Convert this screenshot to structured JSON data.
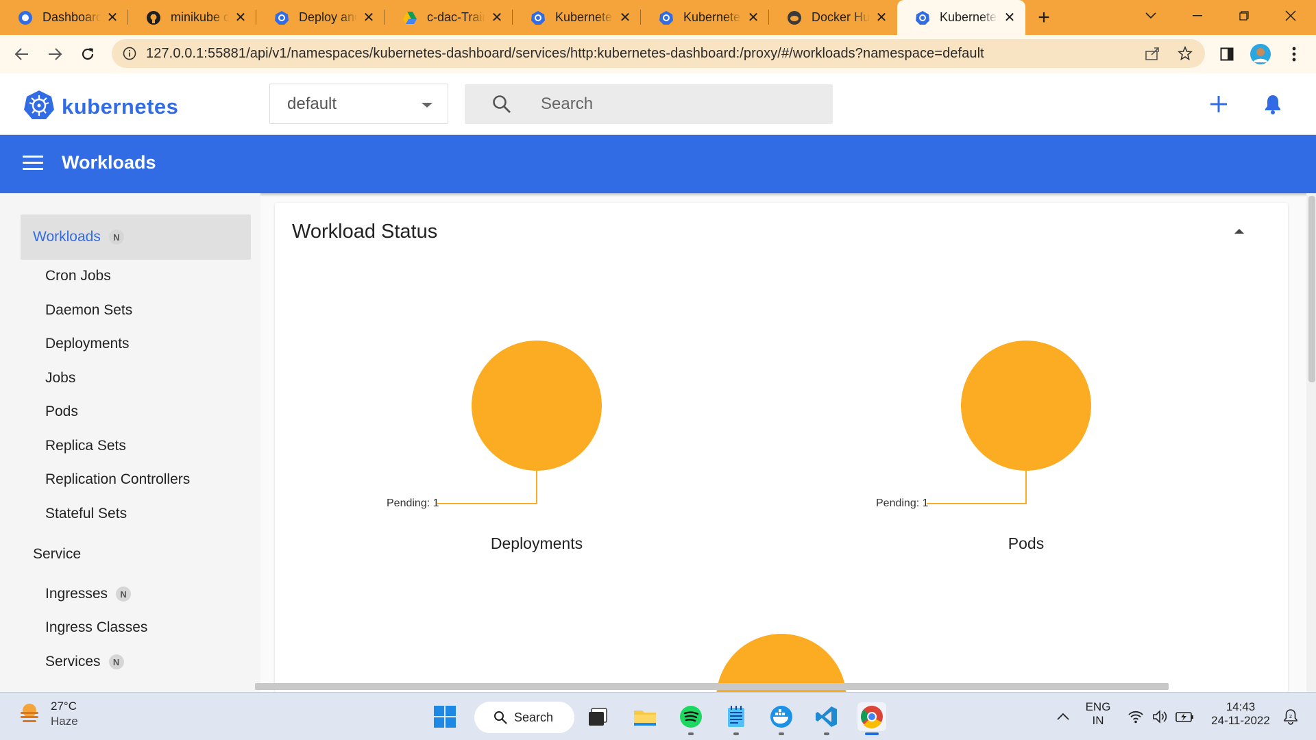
{
  "browser": {
    "tabs": [
      {
        "label": "Dashboard",
        "icon": "dashboard-favicon"
      },
      {
        "label": "minikube d",
        "icon": "github-favicon"
      },
      {
        "label": "Deploy and",
        "icon": "kubernetes-favicon"
      },
      {
        "label": "c-dac-Train",
        "icon": "google-drive-favicon"
      },
      {
        "label": "Kubernetes",
        "icon": "kubernetes-favicon"
      },
      {
        "label": "Kubernetes",
        "icon": "kubernetes-favicon"
      },
      {
        "label": "Docker Hul",
        "icon": "docker-favicon"
      },
      {
        "label": "Kubernetes",
        "icon": "kubernetes-favicon",
        "active": true
      }
    ],
    "url": "127.0.0.1:55881/api/v1/namespaces/kubernetes-dashboard/services/http:kubernetes-dashboard:/proxy/#/workloads?namespace=default",
    "accent_color": "#f4a43a"
  },
  "header": {
    "brand": "kubernetes",
    "namespace": "default",
    "search_placeholder": "Search",
    "brand_color": "#326ce5"
  },
  "toolbar": {
    "title": "Workloads"
  },
  "sidebar": {
    "active": {
      "label": "Workloads",
      "badge": "N"
    },
    "items": [
      {
        "label": "Cron Jobs"
      },
      {
        "label": "Daemon Sets"
      },
      {
        "label": "Deployments"
      },
      {
        "label": "Jobs"
      },
      {
        "label": "Pods"
      },
      {
        "label": "Replica Sets"
      },
      {
        "label": "Replication Controllers"
      },
      {
        "label": "Stateful Sets"
      }
    ],
    "section_service": "Service",
    "service_items": [
      {
        "label": "Ingresses",
        "badge": "N"
      },
      {
        "label": "Ingress Classes"
      },
      {
        "label": "Services",
        "badge": "N"
      }
    ]
  },
  "main": {
    "card_title": "Workload Status",
    "charts": [
      {
        "name": "Deployments",
        "pending_label": "Pending: 1",
        "pending": 1,
        "color": "#fbac22"
      },
      {
        "name": "Pods",
        "pending_label": "Pending: 1",
        "pending": 1,
        "color": "#fbac22"
      }
    ]
  },
  "taskbar": {
    "weather_temp": "27°C",
    "weather_cond": "Haze",
    "search_label": "Search",
    "lang_top": "ENG",
    "lang_bottom": "IN",
    "time": "14:43",
    "date": "24-11-2022"
  }
}
